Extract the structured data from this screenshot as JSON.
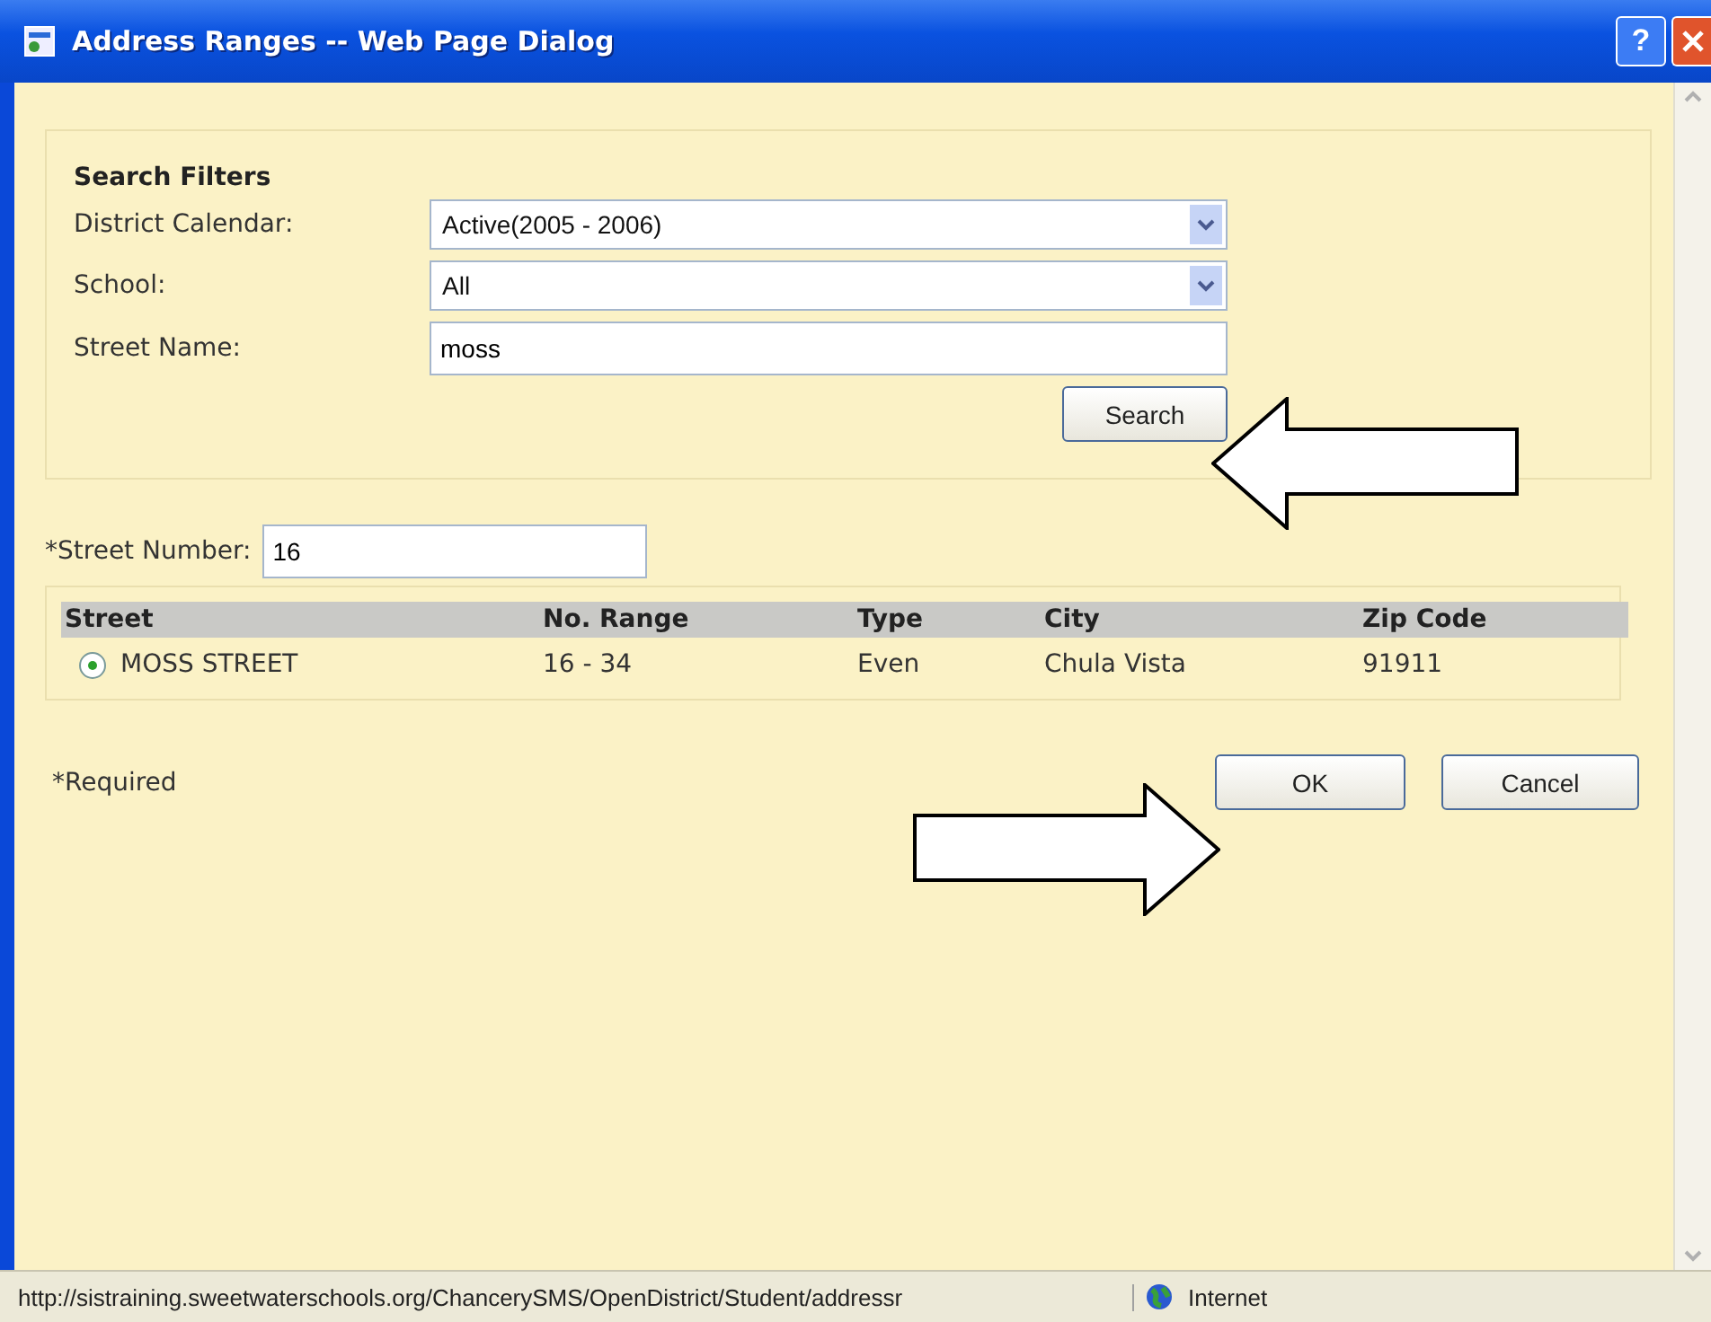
{
  "window": {
    "title": "Address Ranges -- Web Page Dialog",
    "help": "?"
  },
  "filters": {
    "heading": "Search Filters",
    "fields": [
      {
        "kind": "select",
        "label": "District Calendar:",
        "value": "Active(2005 - 2006)"
      },
      {
        "kind": "select",
        "label": "School:",
        "value": "All"
      },
      {
        "kind": "text",
        "label": "Street Name:",
        "value": "moss"
      }
    ],
    "search_button": "Search"
  },
  "street_number": {
    "label": "*Street Number:",
    "value": "16"
  },
  "table": {
    "columns": [
      "Street",
      "No. Range",
      "Type",
      "City",
      "Zip Code"
    ],
    "rows": [
      {
        "selected": true,
        "cells": [
          "MOSS STREET",
          "16 - 34",
          "Even",
          "Chula Vista",
          "91911"
        ]
      }
    ]
  },
  "required_note": "*Required",
  "buttons": [
    "OK",
    "Cancel"
  ],
  "status_bar": {
    "url": "http://sistraining.sweetwaterschools.org/ChancerySMS/OpenDistrict/Student/addressr",
    "zone": "Internet"
  }
}
